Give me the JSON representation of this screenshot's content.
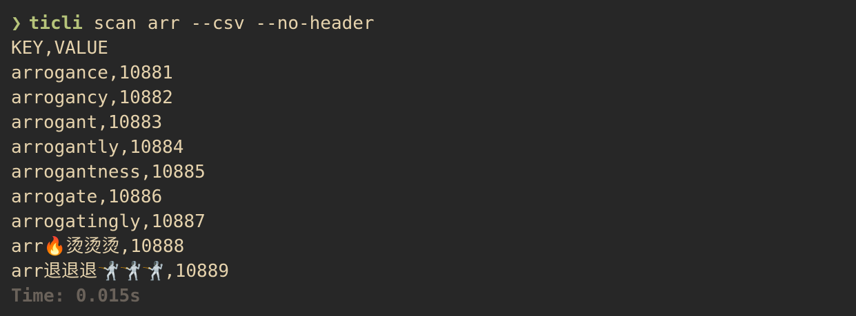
{
  "prompt": {
    "symbol": "❯",
    "command": "ticli",
    "args": " scan arr --csv --no-header"
  },
  "output_lines": [
    "KEY,VALUE",
    "arrogance,10881",
    "arrogancy,10882",
    "arrogant,10883",
    "arrogantly,10884",
    "arrogantness,10885",
    "arrogate,10886",
    "arrogatingly,10887",
    "arr🔥烫烫烫,10888",
    "arr退退退🤺🤺🤺,10889"
  ],
  "timing": "Time: 0.015s",
  "colors": {
    "background": "#272727",
    "prompt_green": "#b6c47a",
    "text": "#e6d3ad",
    "muted": "#6a625a"
  }
}
